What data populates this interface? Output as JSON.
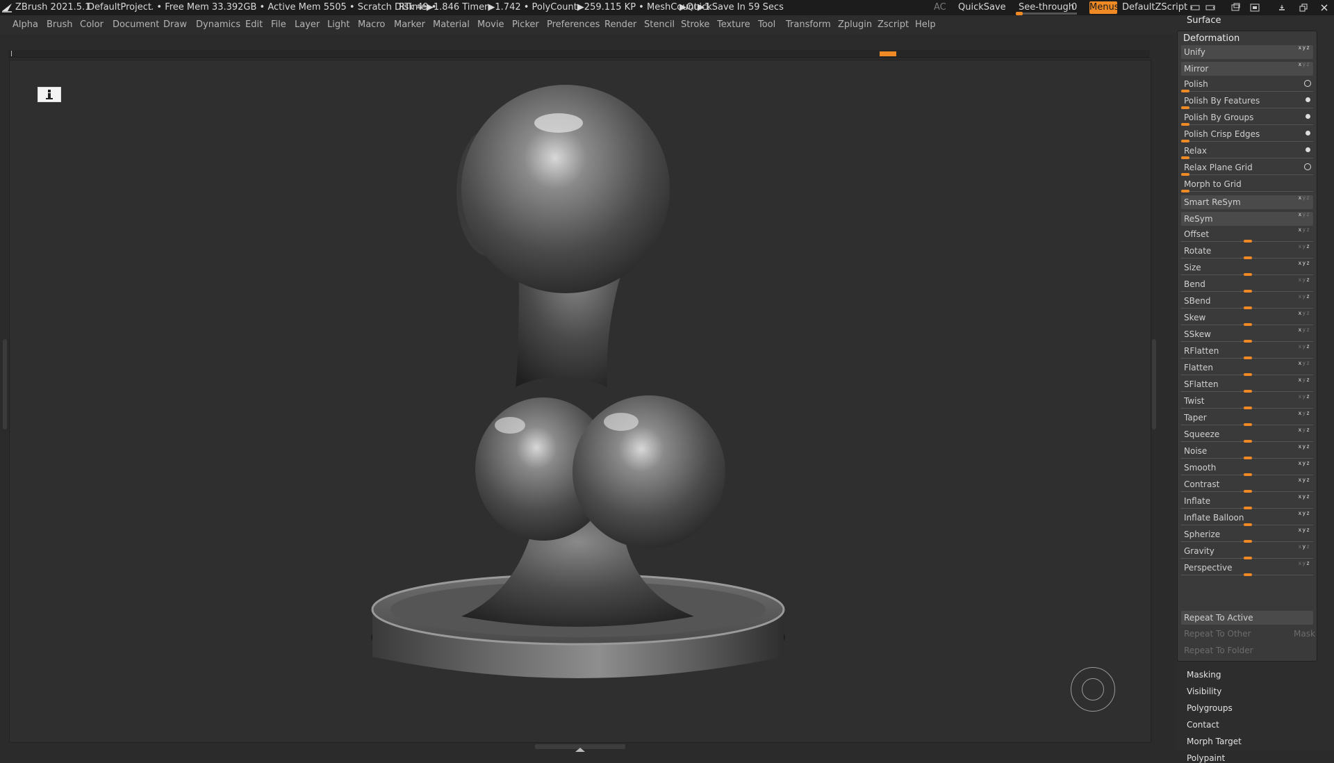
{
  "titlebar": {
    "app": "ZBrush 2021.5.1",
    "project": "DefaultProject",
    "stats": ".. • Free Mem 33.392GB • Active Mem 5505 • Scratch Disk 49 •",
    "rtime": "RTime▶1.846 Timer▶1.742 • PolyCount▶259.115 KP • MeshCount▶1",
    "quicksave_timer": "▶QuickSave In 59 Secs",
    "ac": "AC",
    "quicksave": "QuickSave",
    "see_through_label": "See-through",
    "see_through_value": "0",
    "see_through_level": 0,
    "menus": "Menus",
    "zscript": "DefaultZScript"
  },
  "menubar": [
    "Alpha",
    "Brush",
    "Color",
    "Document",
    "Draw",
    "Dynamics",
    "Edit",
    "File",
    "Layer",
    "Light",
    "Macro",
    "Marker",
    "Material",
    "Movie",
    "Picker",
    "Preferences",
    "Render",
    "Stencil",
    "Stroke",
    "Texture",
    "Tool",
    "Transform",
    "Zplugin",
    "Zscript",
    "Help"
  ],
  "panel": {
    "surface": "Surface",
    "deformation": {
      "title": "Deformation",
      "unify": "Unify",
      "mirror": "Mirror",
      "polish": "Polish",
      "polish_by_features": "Polish By Features",
      "polish_by_groups": "Polish By Groups",
      "polish_crisp_edges": "Polish Crisp Edges",
      "relax": "Relax",
      "relax_plane_grid": "Relax Plane Grid",
      "morph_to_grid": "Morph to Grid",
      "smart_resym": "Smart ReSym",
      "resym": "ReSym",
      "offset": "Offset",
      "rotate": "Rotate",
      "size": "Size",
      "bend": "Bend",
      "sbend": "SBend",
      "skew": "Skew",
      "sskew": "SSkew",
      "rflatten": "RFlatten",
      "flatten": "Flatten",
      "sflatten": "SFlatten",
      "twist": "Twist",
      "taper": "Taper",
      "squeeze": "Squeeze",
      "noise": "Noise",
      "smooth": "Smooth",
      "contrast": "Contrast",
      "inflate": "Inflate",
      "inflate_balloon": "Inflate Balloon",
      "spherize": "Spherize",
      "gravity": "Gravity",
      "perspective": "Perspective",
      "repeat_to_active": "Repeat To Active",
      "repeat_to_other": "Repeat To Other",
      "mask": "Mask",
      "repeat_to_folder": "Repeat To Folder"
    },
    "sections": {
      "masking": "Masking",
      "visibility": "Visibility",
      "polygroups": "Polygroups",
      "contact": "Contact",
      "morph_target": "Morph Target",
      "polypaint": "Polypaint"
    },
    "xyz": "x y z"
  },
  "colors": {
    "accent": "#f08a25",
    "background": "#2b2b2b",
    "viewport": "#2f2f2f",
    "panel": "#3a3a3a"
  },
  "icons": {
    "logo": "zbrush-logo-icon",
    "window_minimize": "minimize-icon",
    "window_restore": "restore-icon",
    "window_close": "close-icon"
  }
}
